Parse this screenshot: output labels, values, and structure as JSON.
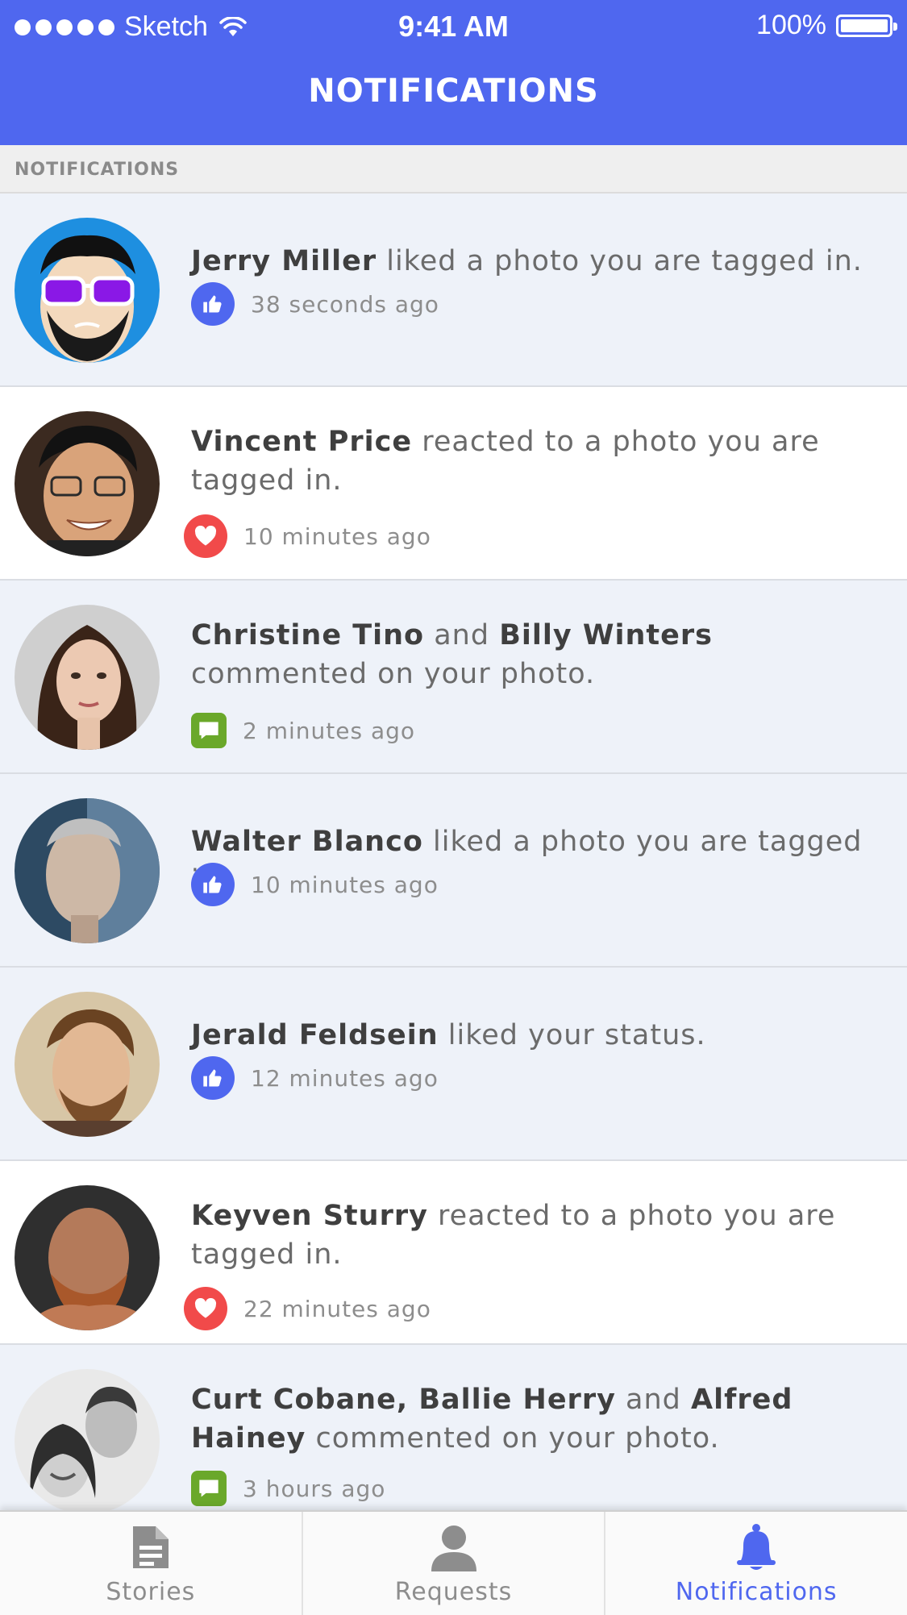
{
  "status_bar": {
    "carrier": "Sketch",
    "time": "9:41 AM",
    "battery": "100%"
  },
  "header": {
    "title": "NOTIFICATIONS"
  },
  "section": {
    "label": "NOTIFICATIONS"
  },
  "notifications": [
    {
      "name1": "Jerry Miller",
      "action": " liked a photo you are tagged in.",
      "time": "38 seconds ago",
      "icon": "like-icon"
    },
    {
      "name1": "Vincent Price",
      "action": " reacted to a photo you are tagged in.",
      "time": "10 minutes ago",
      "icon": "heart-icon"
    },
    {
      "name1": "Christine Tino",
      "joiner": " and ",
      "name2": "Billy Winters",
      "action": " commented on your photo.",
      "time": "2 minutes ago",
      "icon": "comment-icon"
    },
    {
      "name1": "Walter Blanco",
      "action": " liked a photo you are tagged in.",
      "time": "10 minutes ago",
      "icon": "like-icon"
    },
    {
      "name1": "Jerald Feldsein",
      "action": " liked your status.",
      "time": "12 minutes ago",
      "icon": "like-icon"
    },
    {
      "name1": "Keyven Sturry",
      "action": " reacted to a photo you are tagged in.",
      "time": "22 minutes ago",
      "icon": "heart-icon"
    },
    {
      "name1": "Curt Cobane, Ballie Herry",
      "joiner": " and ",
      "name2": "Alfred Hainey",
      "action": " commented on your photo.",
      "time": "3 hours ago",
      "icon": "comment-icon"
    }
  ],
  "tabs": [
    {
      "label": "Stories",
      "icon": "document-icon"
    },
    {
      "label": "Requests",
      "icon": "person-icon"
    },
    {
      "label": "Notifications",
      "icon": "bell-icon",
      "active": true
    }
  ],
  "colors": {
    "brand": "#4f67ef",
    "like": "#4f67ef",
    "love": "#f14a4a",
    "comment": "#6aa82a"
  }
}
